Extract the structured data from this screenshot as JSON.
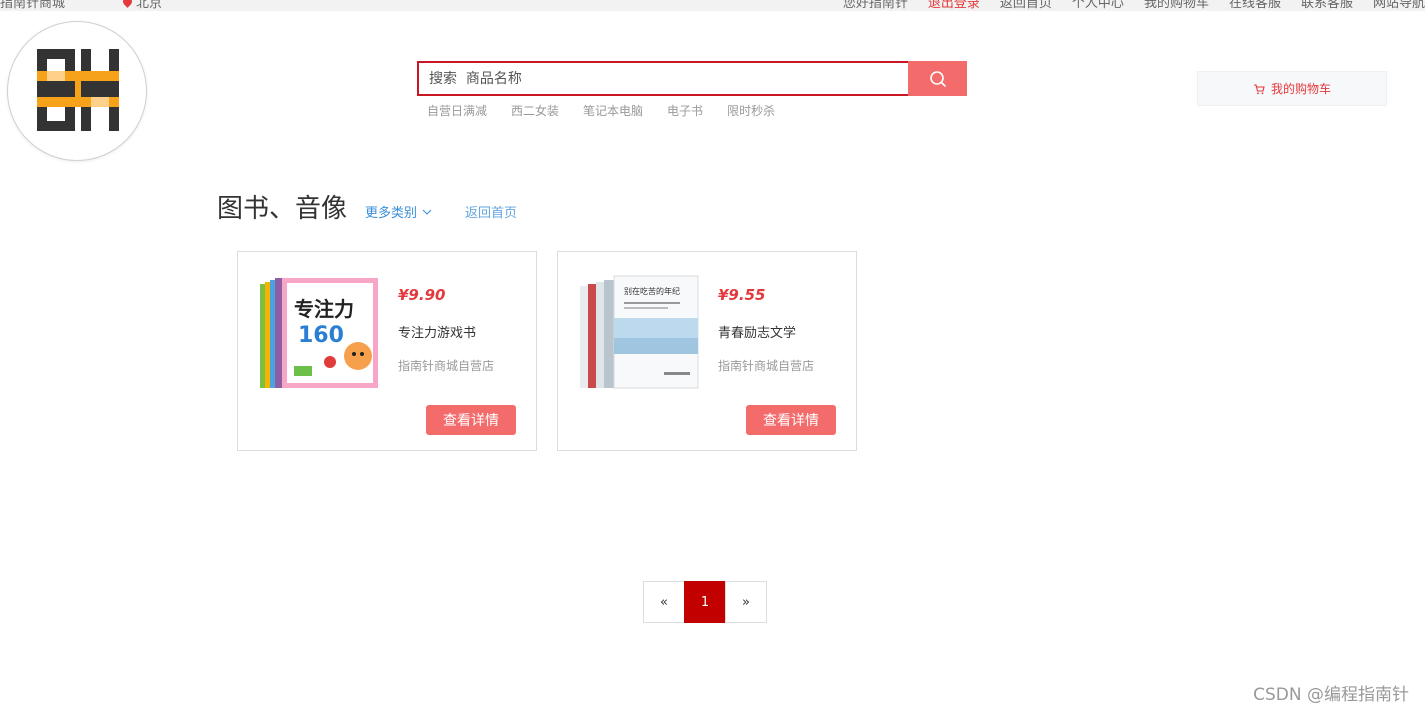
{
  "topbar": {
    "site_name": "指南针商城",
    "location": "北京",
    "links": [
      "您好指南针",
      "退出登录",
      "返回首页",
      "个人中心",
      "我的购物车",
      "在线客服",
      "联系客服",
      "网站导航"
    ]
  },
  "logo": {
    "icon": "compass-logo-icon"
  },
  "search": {
    "placeholder": "搜索  商品名称",
    "hot_words": [
      "自营日满减",
      "西二女装",
      "笔记本电脑",
      "电子书",
      "限时秒杀"
    ]
  },
  "cart": {
    "label": "我的购物车"
  },
  "category": {
    "title": "图书、音像",
    "more_label": "更多类别",
    "back_label": "返回首页"
  },
  "products": [
    {
      "price": "¥9.90",
      "name": "专注力游戏书",
      "shop": "指南针商城自营店",
      "button": "查看详情",
      "cover_text": "专注力",
      "cover_num": "160"
    },
    {
      "price": "¥9.55",
      "name": "青春励志文学",
      "shop": "指南针商城自营店",
      "button": "查看详情",
      "cover_text": "别在吃苦的年纪"
    }
  ],
  "pagination": {
    "prev": "«",
    "current": "1",
    "next": "»"
  },
  "watermark": "CSDN @编程指南针",
  "colors": {
    "accent": "#c81623",
    "button": "#f36b6b",
    "price": "#e4393c",
    "link": "#3a8fd8"
  }
}
